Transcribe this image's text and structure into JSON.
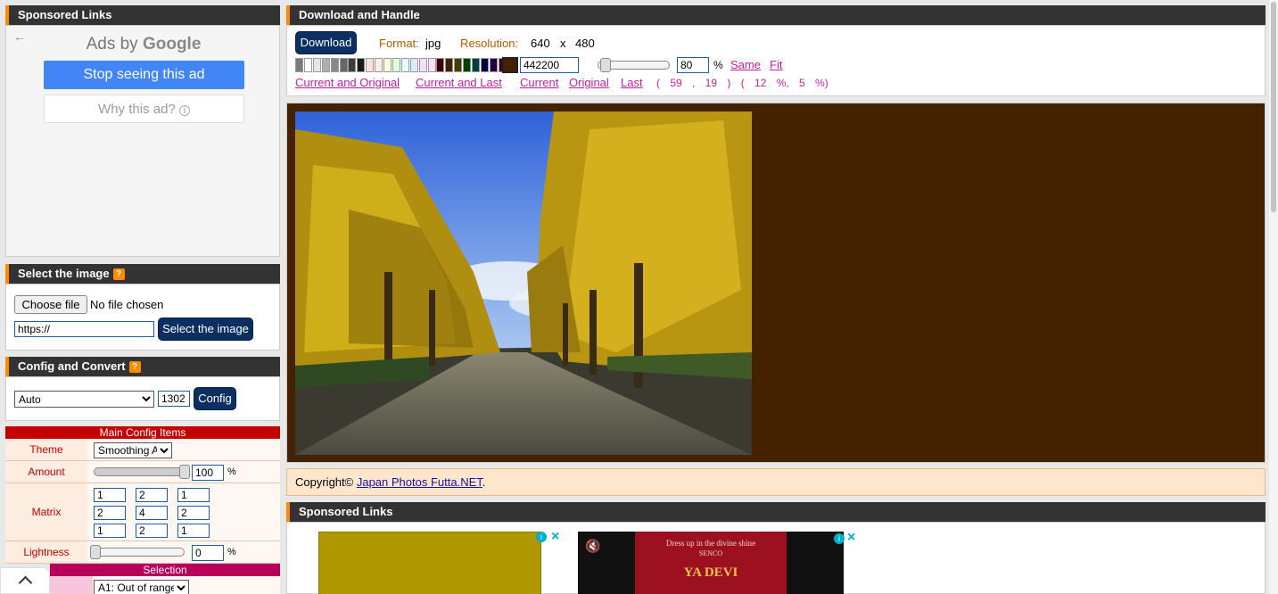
{
  "sponsored_left": {
    "title": "Sponsored Links",
    "ads_by": "Ads by ",
    "google": "Google",
    "stop_button": "Stop seeing this ad",
    "why_button": "Why this ad?"
  },
  "select_image": {
    "title": "Select the image",
    "help": "?",
    "choose_file": "Choose file",
    "no_file": "No file chosen",
    "url_value": "https://",
    "select_button": "Select the image"
  },
  "config_convert": {
    "title": "Config and Convert",
    "help": "?",
    "mode_selected": "Auto",
    "size_value": "1302",
    "config_button": "Config"
  },
  "main_config": {
    "header": "Main Config Items",
    "theme_label": "Theme",
    "theme_selected": "Smoothing A",
    "amount_label": "Amount",
    "amount_value": "100",
    "amount_unit": "%",
    "amount_fraction": 1.0,
    "matrix_label": "Matrix",
    "matrix": [
      [
        "1",
        "2",
        "1"
      ],
      [
        "2",
        "4",
        "2"
      ],
      [
        "1",
        "2",
        "1"
      ]
    ],
    "lightness_label": "Lightness",
    "lightness_value": "0",
    "lightness_unit": "%",
    "selection_header": "Selection",
    "selection_selected": "A1: Out of range"
  },
  "download": {
    "title": "Download and Handle",
    "download_button": "Download",
    "format_label": "Format:",
    "format_value": "jpg",
    "resolution_label": "Resolution:",
    "res_w": "640",
    "res_x": "x",
    "res_h": "480",
    "color_value": "442200",
    "zoom_value": "80",
    "zoom_unit": "%",
    "zoom_fraction": 0.05,
    "same_link": "Same",
    "fit_link": "Fit",
    "links": [
      "Current and Original",
      "Current and Last",
      "Current",
      "Original",
      "Last"
    ],
    "coords": "( 59 , 19 ) ( 12 %, 5 %)"
  },
  "swatches": [
    "#7a7a7a",
    "#ffffff",
    "#e6e6e6",
    "#b0b0b0",
    "#888888",
    "#666666",
    "#3d3d3d",
    "#1a1a1a",
    "#ffe0e0",
    "#ffeedd",
    "#ffffe0",
    "#e0ffe0",
    "#e0ffff",
    "#e0e8ff",
    "#f0e0ff",
    "#ffe0f4",
    "#400000",
    "#402000",
    "#404000",
    "#004000",
    "#004040",
    "#000040",
    "#200040",
    "#400020"
  ],
  "current_color": "#442200",
  "copyright": {
    "prefix": "Copyright©",
    "link": "Japan Photos Futta.NET",
    "suffix": "."
  },
  "sponsored_right": {
    "title": "Sponsored Links",
    "ad_text_1": "Dress up in the divine shine",
    "ad_brand": "SENCO",
    "ad_logo": "YA DEVI"
  },
  "colors": {
    "accent": "#ff8a00",
    "header_bg": "#333333",
    "navy": "#0b2f61",
    "link": "#c21fa6",
    "canvas_bg": "#442200"
  }
}
